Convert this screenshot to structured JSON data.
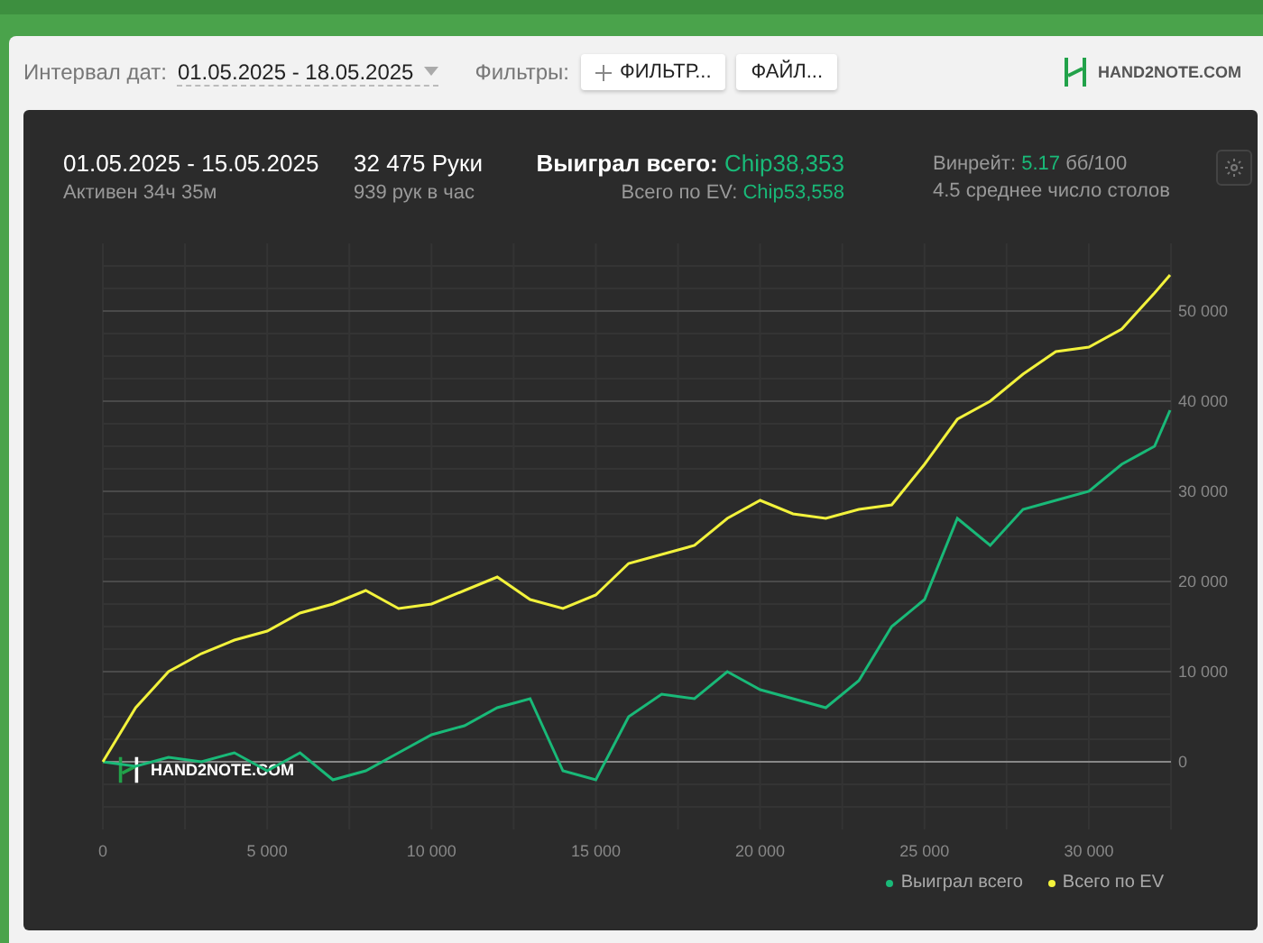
{
  "toolbar": {
    "date_label": "Интервал дат:",
    "date_value": "01.05.2025 - 18.05.2025",
    "filters_label": "Фильтры:",
    "buttons": [
      {
        "kind": "add",
        "label": "ФИЛЬТР..."
      },
      {
        "kind": "plain",
        "label": "ФАЙЛ..."
      }
    ],
    "logo": "HAND**2**NOTE.COM"
  },
  "summary": {
    "period": "01.05.2025 - 15.05.2025",
    "active": "Активен 34ч 35м",
    "hands": "32 475 Руки",
    "hands_per_hour": "939 рук в час",
    "won_label": "Выиграл всего:",
    "won_value": "Chip38,353",
    "ev_label": "Всего по EV:",
    "ev_value": "Chip53,558",
    "winrate_label": "Винрейт:",
    "winrate_value": "5.17",
    "winrate_unit": "бб/100",
    "tables": "4.5 среднее число столов"
  },
  "chart": {
    "watermark": "HAND**2**NOTE.COM",
    "chart_data": {
      "type": "line",
      "x": [
        0,
        1000,
        2000,
        3000,
        4000,
        5000,
        6000,
        7000,
        8000,
        9000,
        10000,
        11000,
        12000,
        13000,
        14000,
        15000,
        16000,
        17000,
        18000,
        19000,
        20000,
        21000,
        22000,
        23000,
        24000,
        25000,
        26000,
        27000,
        28000,
        29000,
        30000,
        31000,
        32000,
        32475
      ],
      "series": [
        {
          "name": "Выиграл всего",
          "color": "#19b978",
          "values": [
            0,
            -500,
            500,
            0,
            1000,
            -1000,
            1000,
            -2000,
            -1000,
            1000,
            3000,
            4000,
            6000,
            7000,
            -1000,
            -2000,
            5000,
            7500,
            7000,
            10000,
            8000,
            7000,
            6000,
            9000,
            15000,
            18000,
            27000,
            24000,
            28000,
            29000,
            30000,
            33000,
            35000,
            39000
          ]
        },
        {
          "name": "Всего по EV",
          "color": "#f2f23c",
          "values": [
            0,
            6000,
            10000,
            12000,
            13500,
            14500,
            16500,
            17500,
            19000,
            17000,
            17500,
            19000,
            20500,
            18000,
            17000,
            18500,
            22000,
            23000,
            24000,
            27000,
            29000,
            27500,
            27000,
            28000,
            28500,
            33000,
            38000,
            40000,
            43000,
            45500,
            46000,
            48000,
            52000,
            54000
          ]
        }
      ],
      "grid": true,
      "xlim": [
        0,
        32500
      ],
      "ylim": [
        -7500,
        57500
      ],
      "xticks": [
        {
          "value": 0,
          "label": "0"
        },
        {
          "value": 5000,
          "label": "5 000"
        },
        {
          "value": 10000,
          "label": "10 000"
        },
        {
          "value": 15000,
          "label": "15 000"
        },
        {
          "value": 20000,
          "label": "20 000"
        },
        {
          "value": 25000,
          "label": "25 000"
        },
        {
          "value": 30000,
          "label": "30 000"
        }
      ],
      "yticks": [
        {
          "value": 0,
          "label": "0"
        },
        {
          "value": 10000,
          "label": "10 000"
        },
        {
          "value": 20000,
          "label": "20 000"
        },
        {
          "value": 30000,
          "label": "30 000"
        },
        {
          "value": 40000,
          "label": "40 000"
        },
        {
          "value": 50000,
          "label": "50 000"
        }
      ]
    }
  }
}
